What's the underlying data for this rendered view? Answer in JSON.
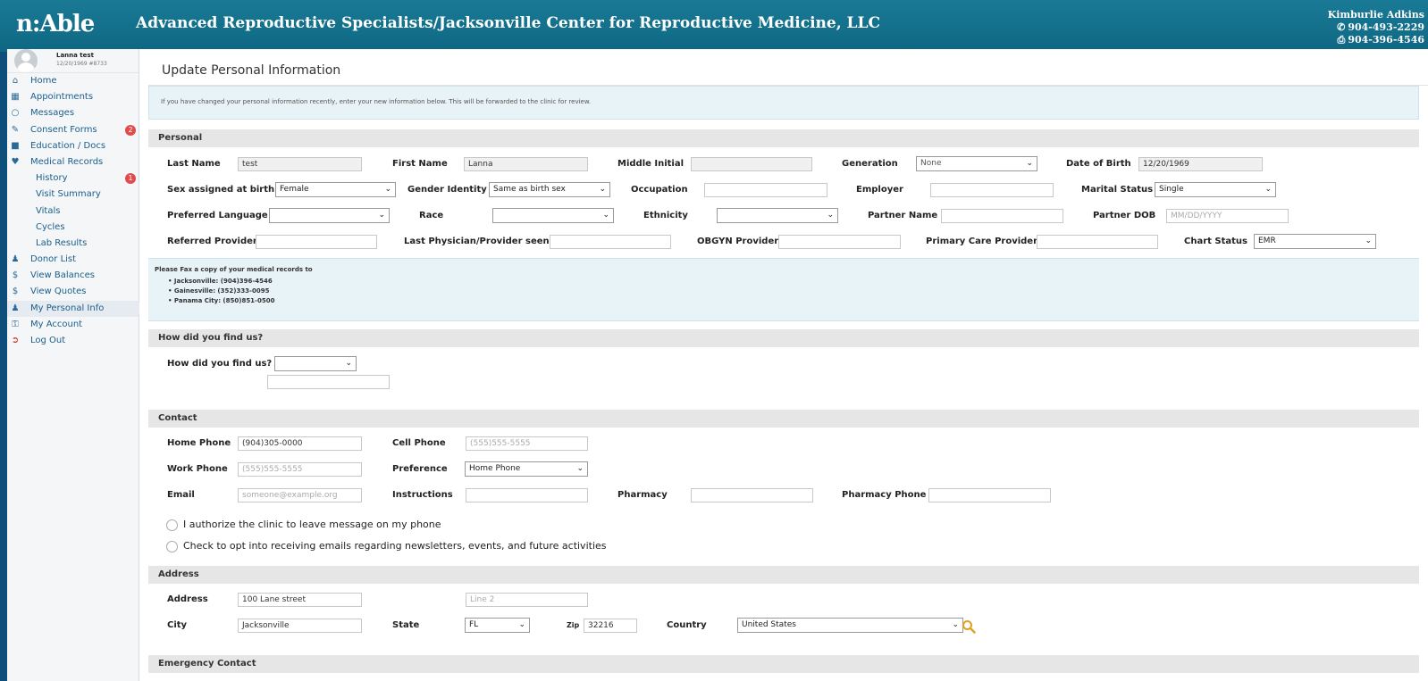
{
  "header": {
    "logo": "n:Able",
    "clinic": "Advanced Reproductive Specialists/Jacksonville Center for Reproductive Medicine, LLC",
    "contact_name": "Kimburlie Adkins",
    "phone": "904-493-2229",
    "fax": "904-396-4546",
    "colors": {
      "header": "#1a7a96",
      "frame": "#0d4f7a"
    }
  },
  "profile": {
    "name": "Lanna test",
    "dob_id": "12/20/1969 #8733"
  },
  "sidebar": {
    "items": [
      {
        "label": "Home",
        "icon": "home-icon"
      },
      {
        "label": "Appointments",
        "icon": "calendar-icon"
      },
      {
        "label": "Messages",
        "icon": "chat-icon"
      },
      {
        "label": "Consent Forms",
        "icon": "edit-icon",
        "badge": "2"
      },
      {
        "label": "Education / Docs",
        "icon": "book-icon"
      },
      {
        "label": "Medical Records",
        "icon": "heart-icon"
      },
      {
        "label": "History",
        "badge": "1"
      },
      {
        "label": "Visit Summary"
      },
      {
        "label": "Vitals"
      },
      {
        "label": "Cycles"
      },
      {
        "label": "Lab Results"
      },
      {
        "label": "Donor List",
        "icon": "users-icon"
      },
      {
        "label": "View Balances",
        "icon": "dollar-icon"
      },
      {
        "label": "View Quotes",
        "icon": "dollar-icon"
      },
      {
        "label": "My Personal Info",
        "icon": "user-icon"
      },
      {
        "label": "My Account",
        "icon": "key-icon"
      },
      {
        "label": "Log Out",
        "icon": "logout-icon"
      }
    ]
  },
  "main": {
    "title": "Update Personal Information",
    "banner": "If you have changed your personal information recently, enter your new information below. This will be forwarded to the clinic for review.",
    "personal": {
      "heading": "Personal",
      "last_name_label": "Last Name",
      "last_name": "test",
      "first_name_label": "First Name",
      "first_name": "Lanna",
      "middle_label": "Middle Initial",
      "middle": "",
      "generation_label": "Generation",
      "generation": "None",
      "dob_label": "Date of Birth",
      "dob": "12/20/1969",
      "sex_label": "Sex assigned at birth",
      "sex": "Female",
      "gender_label": "Gender Identity",
      "gender": "Same as birth sex",
      "occupation_label": "Occupation",
      "occupation": "",
      "employer_label": "Employer",
      "employer": "",
      "marital_label": "Marital Status",
      "marital": "Single",
      "language_label": "Preferred Language",
      "language": "",
      "race_label": "Race",
      "race": "",
      "ethnicity_label": "Ethnicity",
      "ethnicity": "",
      "partner_name_label": "Partner Name",
      "partner_name": "",
      "partner_dob_label": "Partner DOB",
      "partner_dob_ph": "MM/DD/YYYY",
      "referred_label": "Referred Provider",
      "referred": "",
      "last_physician_label": "Last Physician/Provider seen",
      "last_physician": "",
      "obgyn_label": "OBGYN Provider",
      "obgyn": "",
      "pcp_label": "Primary Care Provider",
      "pcp": "",
      "chart_status_label": "Chart Status",
      "chart_status": "EMR"
    },
    "fax": {
      "title": "Please Fax a copy of your medical records to",
      "items": [
        "Jacksonville: (904)396-4546",
        "Gainesville: (352)333-0095",
        "Panama City: (850)851-0500"
      ]
    },
    "find": {
      "heading": "How did you find us?",
      "label": "How did you find us?",
      "value": "",
      "other": ""
    },
    "contact": {
      "heading": "Contact",
      "home_phone_label": "Home Phone",
      "home_phone": "(904)305-0000",
      "cell_phone_label": "Cell Phone",
      "cell_phone_ph": "(555)555-5555",
      "work_phone_label": "Work Phone",
      "work_phone_ph": "(555)555-5555",
      "preference_label": "Preference",
      "preference": "Home Phone",
      "email_label": "Email",
      "email_ph": "someone@example.org",
      "instructions_label": "Instructions",
      "instructions": "",
      "pharmacy_label": "Pharmacy",
      "pharmacy": "",
      "pharmacy_phone_label": "Pharmacy Phone",
      "pharmacy_phone": "",
      "authorize": "I authorize the clinic to leave message on my phone",
      "optin": "Check to opt into receiving emails regarding newsletters, events, and future activities"
    },
    "address": {
      "heading": "Address",
      "address_label": "Address",
      "address": "100 Lane street",
      "line2_ph": "Line 2",
      "city_label": "City",
      "city": "Jacksonville",
      "state_label": "State",
      "state": "FL",
      "zip_label": "Zip",
      "zip": "32216",
      "country_label": "Country",
      "country": "United States"
    },
    "emergency": {
      "heading": "Emergency Contact"
    }
  }
}
